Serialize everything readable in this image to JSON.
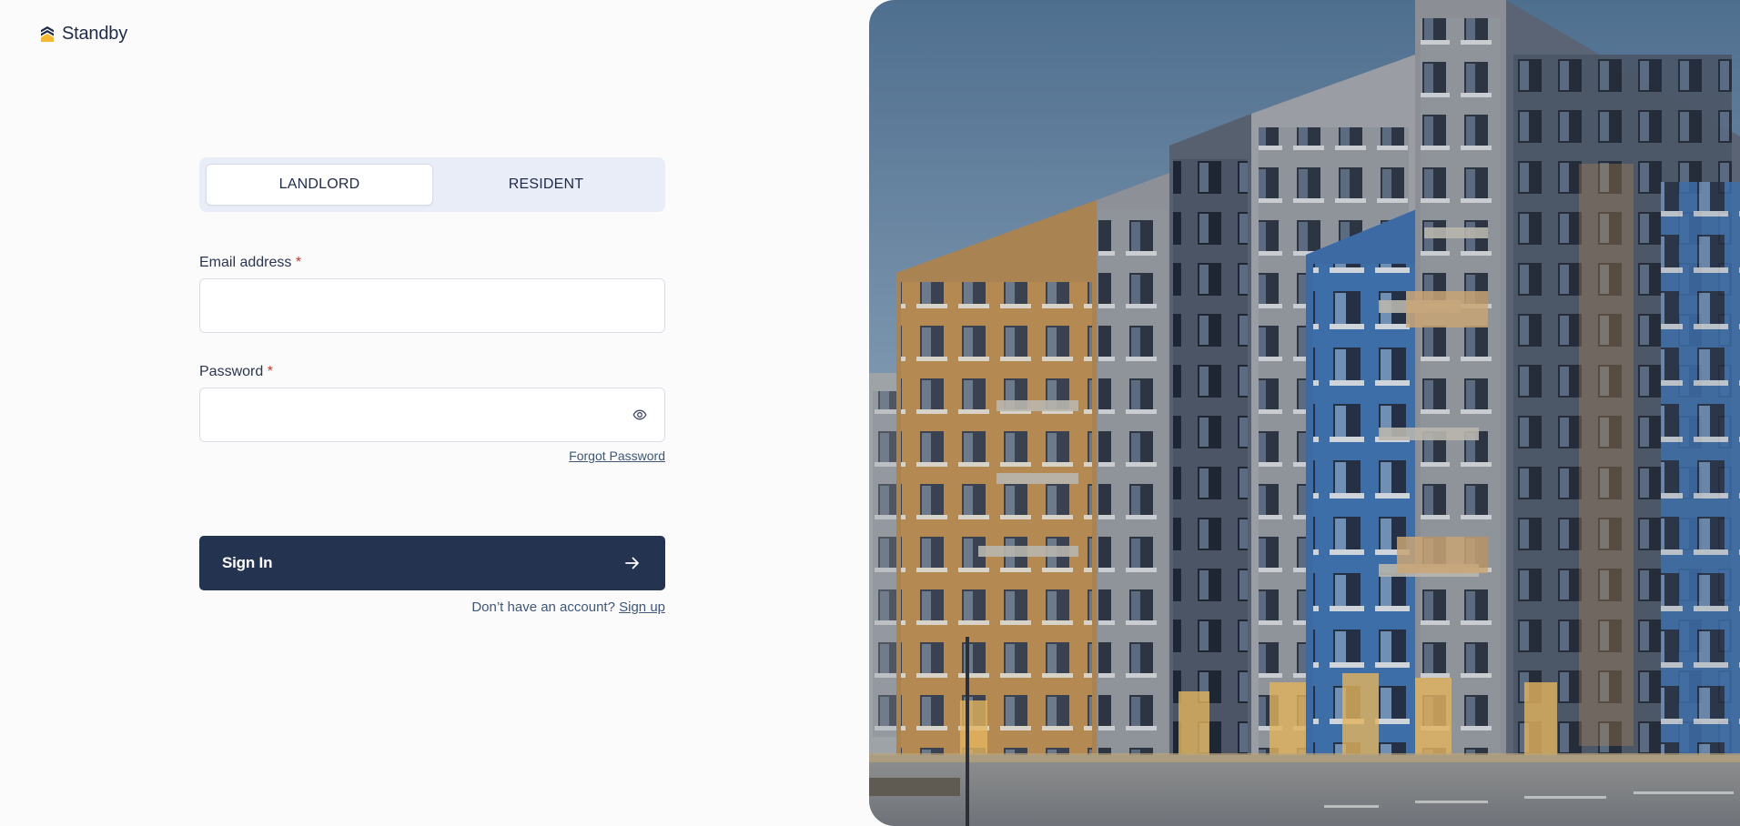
{
  "brand": {
    "name": "Standby",
    "logo_icon": "standby-logo-icon",
    "accent": "#f5b82e",
    "primary": "#243350"
  },
  "role_toggle": {
    "tabs": [
      {
        "label": "LANDLORD",
        "active": true
      },
      {
        "label": "RESIDENT",
        "active": false
      }
    ]
  },
  "form": {
    "email": {
      "label": "Email address",
      "required_mark": "*",
      "value": "",
      "placeholder": ""
    },
    "password": {
      "label": "Password",
      "required_mark": "*",
      "value": "",
      "placeholder": "",
      "toggle_icon": "eye-icon"
    },
    "forgot_password": "Forgot Password",
    "submit_label": "Sign In",
    "submit_icon": "arrow-right-icon",
    "signup_prompt": "Don’t have an account?",
    "signup_link": "Sign up"
  },
  "hero_image": {
    "subject": "apartment-building-photo"
  }
}
